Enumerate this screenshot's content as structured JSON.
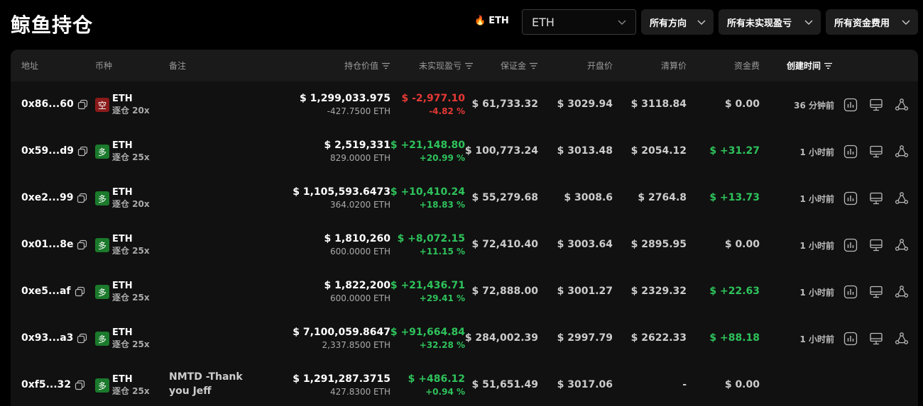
{
  "page_title": "鲸鱼持仓",
  "toolbar": {
    "hot_label": "ETH",
    "select_value": "ETH",
    "filters": [
      "所有方向",
      "所有未实现盈亏",
      "所有资金费用"
    ]
  },
  "table": {
    "headers": {
      "address": "地址",
      "coin": "币种",
      "note": "备注",
      "position_value": "持仓价值",
      "unrealized_pnl": "未实现盈亏",
      "margin": "保证金",
      "open_price": "开盘价",
      "liq_price": "清算价",
      "funding": "资金费",
      "created": "创建时间"
    },
    "rows": [
      {
        "address": "0x86...60",
        "dir_label": "空",
        "dir": "short",
        "coin": "ETH",
        "leverage": "逐仓 20x",
        "note": "",
        "value": "$ 1,299,033.975",
        "size": "-427.7500 ETH",
        "pnl": "$ -2,977.10",
        "pnl_pct": "-4.82 %",
        "pnl_sign": "neg",
        "margin": "$ 61,733.32",
        "open": "$ 3029.94",
        "liq": "$ 3118.84",
        "fee": "$ 0.00",
        "fee_sign": "zero",
        "time": "36 分钟前"
      },
      {
        "address": "0x59...d9",
        "dir_label": "多",
        "dir": "long",
        "coin": "ETH",
        "leverage": "逐仓 25x",
        "note": "",
        "value": "$ 2,519,331",
        "size": "829.0000 ETH",
        "pnl": "$ +21,148.80",
        "pnl_pct": "+20.99 %",
        "pnl_sign": "pos",
        "margin": "$ 100,773.24",
        "open": "$ 3013.48",
        "liq": "$ 2054.12",
        "fee": "$ +31.27",
        "fee_sign": "pos",
        "time": "1 小时前"
      },
      {
        "address": "0xe2...99",
        "dir_label": "多",
        "dir": "long",
        "coin": "ETH",
        "leverage": "逐仓 20x",
        "note": "",
        "value": "$ 1,105,593.6473",
        "size": "364.0200 ETH",
        "pnl": "$ +10,410.24",
        "pnl_pct": "+18.83 %",
        "pnl_sign": "pos",
        "margin": "$ 55,279.68",
        "open": "$ 3008.6",
        "liq": "$ 2764.8",
        "fee": "$ +13.73",
        "fee_sign": "pos",
        "time": "1 小时前"
      },
      {
        "address": "0x01...8e",
        "dir_label": "多",
        "dir": "long",
        "coin": "ETH",
        "leverage": "逐仓 25x",
        "note": "",
        "value": "$ 1,810,260",
        "size": "600.0000 ETH",
        "pnl": "$ +8,072.15",
        "pnl_pct": "+11.15 %",
        "pnl_sign": "pos",
        "margin": "$ 72,410.40",
        "open": "$ 3003.64",
        "liq": "$ 2895.95",
        "fee": "$ 0.00",
        "fee_sign": "zero",
        "time": "1 小时前"
      },
      {
        "address": "0xe5...af",
        "dir_label": "多",
        "dir": "long",
        "coin": "ETH",
        "leverage": "逐仓 25x",
        "note": "",
        "value": "$ 1,822,200",
        "size": "600.0000 ETH",
        "pnl": "$ +21,436.71",
        "pnl_pct": "+29.41 %",
        "pnl_sign": "pos",
        "margin": "$ 72,888.00",
        "open": "$ 3001.27",
        "liq": "$ 2329.32",
        "fee": "$ +22.63",
        "fee_sign": "pos",
        "time": "1 小时前"
      },
      {
        "address": "0x93...a3",
        "dir_label": "多",
        "dir": "long",
        "coin": "ETH",
        "leverage": "逐仓 25x",
        "note": "",
        "value": "$ 7,100,059.8647",
        "size": "2,337.8500 ETH",
        "pnl": "$ +91,664.84",
        "pnl_pct": "+32.28 %",
        "pnl_sign": "pos",
        "margin": "$ 284,002.39",
        "open": "$ 2997.79",
        "liq": "$ 2622.33",
        "fee": "$ +88.18",
        "fee_sign": "pos",
        "time": "1 小时前"
      },
      {
        "address": "0xf5...32",
        "dir_label": "多",
        "dir": "long",
        "coin": "ETH",
        "leverage": "逐仓 25x",
        "note": "NMTD -Thank you Jeff",
        "value": "$ 1,291,287.3715",
        "size": "427.8300 ETH",
        "pnl": "$ +486.12",
        "pnl_pct": "+0.94 %",
        "pnl_sign": "pos",
        "margin": "$ 51,651.49",
        "open": "$ 3017.06",
        "liq": "-",
        "fee": "$ 0.00",
        "fee_sign": "zero",
        "time": ""
      }
    ]
  },
  "colors": {
    "negative": "#e53935",
    "positive": "#2ec25b",
    "short": "#8b1b1b",
    "long": "#1b7a2c"
  },
  "icons": {
    "hot": "flame-icon",
    "copy": "copy-icon",
    "chart": "chart-icon",
    "monitor": "monitor-icon",
    "share": "share-icon",
    "sort": "sort-icon",
    "chevron": "chevron-down-icon"
  }
}
